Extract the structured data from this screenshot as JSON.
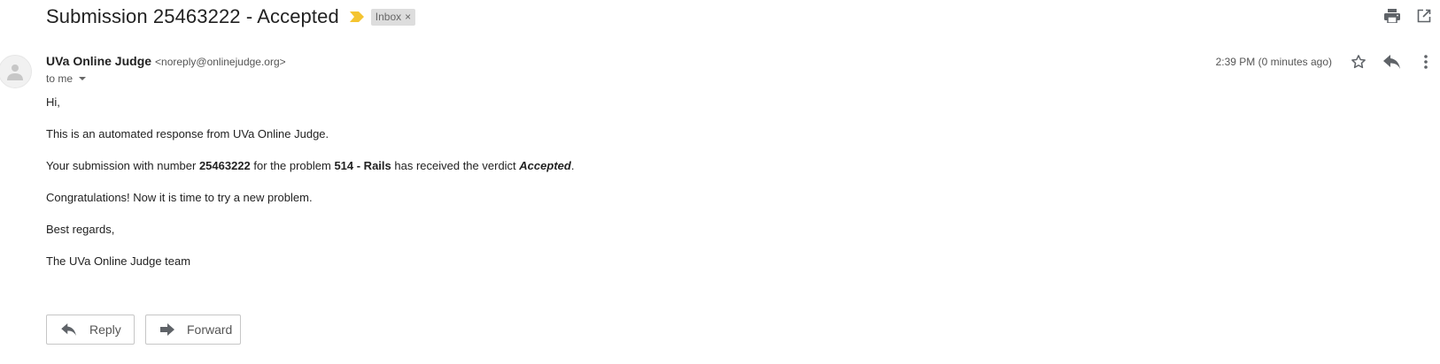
{
  "subject": {
    "text": "Submission 25463222 - Accepted",
    "label": "Inbox",
    "label_remove": "×",
    "importance_color": "#f4c430"
  },
  "toolbar_icons": [
    "print-icon",
    "open-in-new-window-icon"
  ],
  "sender": {
    "name": "UVa Online Judge",
    "email": "<noreply@onlinejudge.org>",
    "recipient": "to me"
  },
  "message_meta": {
    "timestamp": "2:39 PM (0 minutes ago)",
    "icons": [
      "star-icon",
      "reply-icon",
      "more-vert-icon"
    ]
  },
  "body": {
    "greeting": "Hi,",
    "intro": "This is an automated response from UVa Online Judge.",
    "submission_prefix": "Your submission with number ",
    "submission_number": "25463222",
    "problem_prefix": " for the problem ",
    "problem": "514 - Rails",
    "verdict_prefix": " has received the verdict ",
    "verdict": "Accepted",
    "verdict_suffix": ".",
    "congrats": "Congratulations! Now it is time to try a new problem.",
    "closing": "Best regards,",
    "signature": "The UVa Online Judge team"
  },
  "actions": {
    "reply_label": "Reply",
    "forward_label": "Forward"
  },
  "colors": {
    "text": "#222222",
    "secondary_text": "#555555",
    "icon": "#5f6368",
    "chip_bg": "#dddddd"
  }
}
